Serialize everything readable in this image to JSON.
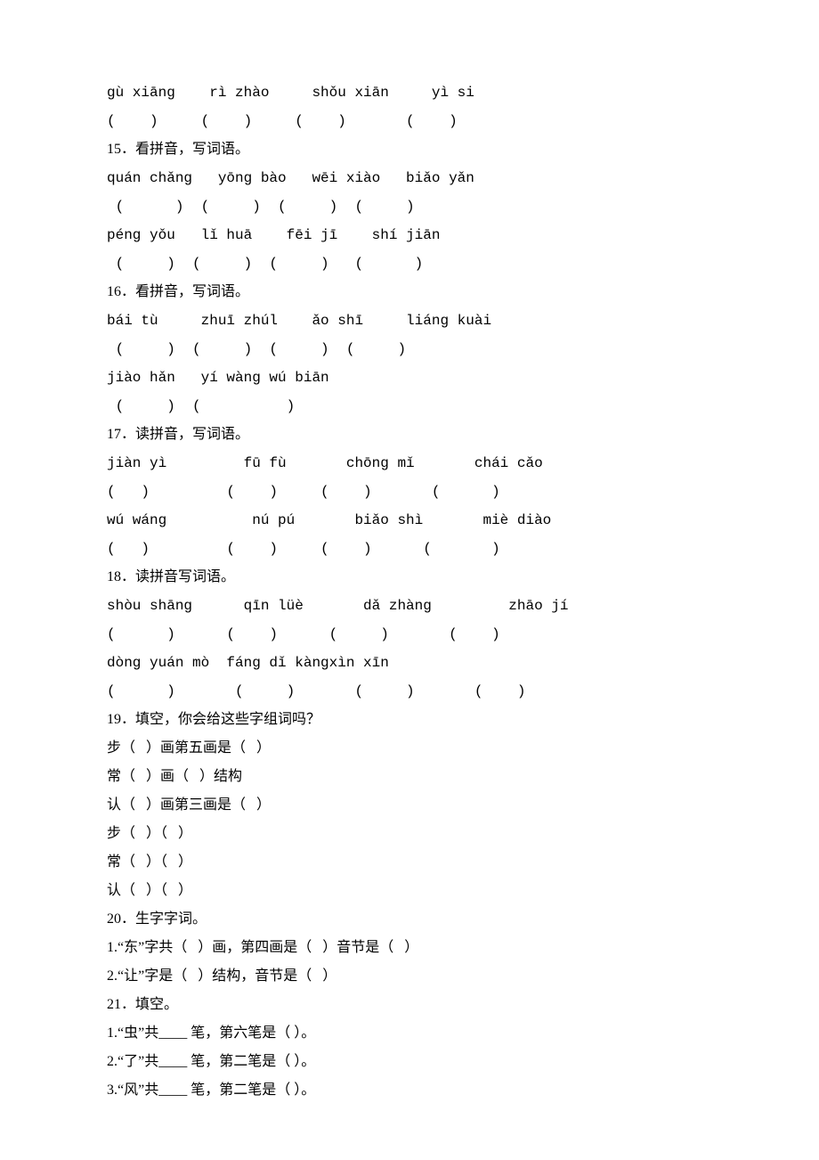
{
  "l01": "gù xiāng    rì zhào     shǒu xiān     yì si",
  "l02": "(    )     (    )     (    )       (    )",
  "l03": "15．看拼音，写词语。",
  "l04": "quán chǎng   yōng bào   wēi xiào   biǎo yǎn",
  "l05": " (      )  (     )  (     )  (     )",
  "l06": "péng yǒu   lǐ huā    fēi jī    shí jiān",
  "l07": " (     )  (     )  (     )   (      )",
  "l08": "16．看拼音，写词语。",
  "l09": "bái tù     zhuī zhúl    ǎo shī     liáng kuài",
  "l10": " (     )  (     )  (     )  (     )",
  "l11": "jiào hǎn   yí wàng wú biān",
  "l12": " (     )  (          )",
  "l13": "17．读拼音，写词语。",
  "l14": "jiàn yì         fū fù       chōng mǐ       chái cǎo",
  "l15": "(   )         (    )     (    )       (      )",
  "l16": "wú wáng          nú pú       biǎo shì       miè diào",
  "l17": "(   )         (    )     (    )      (       )",
  "l18": "18．读拼音写词语。",
  "l19": "shòu shāng      qīn lüè       dǎ zhàng         zhāo jí",
  "l20": "(      )      (    )      (     )       (    )",
  "l21": "dòng yuán mò  fáng dǐ kàngxìn xīn",
  "l22": "(      )       (     )       (     )       (    )",
  "l23": "19．填空，你会给这些字组词吗？",
  "l24": "步（   ）画第五画是（   ）",
  "l25": "常（   ）画（   ）结构",
  "l26": "认（   ）画第三画是（   ）",
  "l27": "步（   ）（   ）",
  "l28": "常（   ）（   ）",
  "l29": "认（   ）（   ）",
  "l30": "20．生字字词。",
  "l31": "1.“东”字共（   ）画，第四画是（   ）音节是（   ）",
  "l32": "2.“让”字是（   ）结构，音节是（   ）",
  "l33": "21．填空。",
  "l34": "1.“虫”共____ 笔，第六笔是（ ）。",
  "l35": "2.“了”共____ 笔，第二笔是（ ）。",
  "l36": "3.“风”共____ 笔，第二笔是（ ）。"
}
